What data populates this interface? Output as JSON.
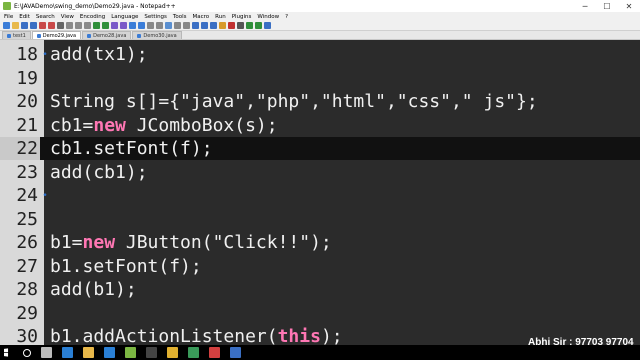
{
  "window": {
    "title": "E:\\JAVADemo\\swing_demo\\Demo29.java - Notepad++",
    "minimize": "─",
    "maximize": "☐",
    "close": "✕"
  },
  "menu": [
    "File",
    "Edit",
    "Search",
    "View",
    "Encoding",
    "Language",
    "Settings",
    "Tools",
    "Macro",
    "Run",
    "Plugins",
    "Window",
    "?"
  ],
  "tabs": [
    {
      "label": "test1",
      "active": false
    },
    {
      "label": "Demo29.java",
      "active": true
    },
    {
      "label": "Demo28.java",
      "active": false
    },
    {
      "label": "Demo30.java",
      "active": false
    }
  ],
  "editor": {
    "current_line": 22,
    "lines": [
      {
        "num": "18",
        "fold": "•",
        "segments": [
          {
            "t": "add(tx1);",
            "k": ""
          }
        ]
      },
      {
        "num": "19",
        "fold": "",
        "segments": []
      },
      {
        "num": "20",
        "fold": "",
        "segments": [
          {
            "t": "String s[]={\"java\",\"php\",\"html\",\"css\",\" js\"};",
            "k": ""
          }
        ]
      },
      {
        "num": "21",
        "fold": "",
        "segments": [
          {
            "t": "cb1=",
            "k": ""
          },
          {
            "t": "new",
            "k": "kw"
          },
          {
            "t": " JComboBox(s);",
            "k": ""
          }
        ]
      },
      {
        "num": "22",
        "fold": "",
        "segments": [
          {
            "t": "cb1.setFont(f);",
            "k": ""
          }
        ]
      },
      {
        "num": "23",
        "fold": "",
        "segments": [
          {
            "t": "add(cb1);",
            "k": ""
          }
        ]
      },
      {
        "num": "24",
        "fold": "•",
        "segments": []
      },
      {
        "num": "25",
        "fold": "",
        "segments": []
      },
      {
        "num": "26",
        "fold": "",
        "segments": [
          {
            "t": "b1=",
            "k": ""
          },
          {
            "t": "new",
            "k": "kw"
          },
          {
            "t": " JButton(\"Click!!\");",
            "k": ""
          }
        ]
      },
      {
        "num": "27",
        "fold": "",
        "segments": [
          {
            "t": "b1.setFont(f);",
            "k": ""
          }
        ]
      },
      {
        "num": "28",
        "fold": "",
        "segments": [
          {
            "t": "add(b1);",
            "k": ""
          }
        ]
      },
      {
        "num": "29",
        "fold": "",
        "segments": []
      },
      {
        "num": "30",
        "fold": "",
        "segments": [
          {
            "t": "b1.addActionListener(",
            "k": ""
          },
          {
            "t": "this",
            "k": "kw"
          },
          {
            "t": ");",
            "k": ""
          }
        ]
      }
    ]
  },
  "caption": "Abhi Sir : 97703 97704",
  "toolbar_icons": [
    "new-file-icon",
    "open-icon",
    "save-icon",
    "save-all-icon",
    "close-icon",
    "close-all-icon",
    "print-icon",
    "cut-icon",
    "copy-icon",
    "paste-icon",
    "undo-icon",
    "redo-icon",
    "find-icon",
    "replace-icon",
    "zoom-in-icon",
    "zoom-out-icon",
    "sync-v-icon",
    "sync-h-icon",
    "wrap-icon",
    "show-all-icon",
    "indent-guide-icon",
    "lang-icon",
    "doc-map-icon",
    "function-list-icon",
    "folder-icon",
    "record-icon",
    "stop-icon",
    "play-icon",
    "play-multi-icon",
    "save-macro-icon"
  ],
  "toolbar_colors": [
    "#3b7dd8",
    "#e8b84a",
    "#3a6fc4",
    "#3a6fc4",
    "#c94a4a",
    "#c94a4a",
    "#666666",
    "#8a8a8a",
    "#8a8a8a",
    "#8a8a8a",
    "#2f8f3a",
    "#2f8f3a",
    "#7a5ac8",
    "#7a5ac8",
    "#3b7dd8",
    "#3b7dd8",
    "#888888",
    "#888888",
    "#5a8fd0",
    "#888888",
    "#888888",
    "#3a6fc4",
    "#3a6fc4",
    "#3a6fc4",
    "#d89a2a",
    "#c03030",
    "#555555",
    "#2f8f3a",
    "#2f8f3a",
    "#3a6fc4"
  ],
  "taskbar_icons": [
    {
      "name": "start-icon",
      "color": "#ffffff"
    },
    {
      "name": "search-icon",
      "color": "#ffffff"
    },
    {
      "name": "task-view-icon",
      "color": "#bbbbbb"
    },
    {
      "name": "edge-icon",
      "color": "#2a7fd4"
    },
    {
      "name": "explorer-icon",
      "color": "#e8b84a"
    },
    {
      "name": "store-icon",
      "color": "#2a7fd4"
    },
    {
      "name": "notepadpp-icon",
      "color": "#7bb642"
    },
    {
      "name": "cmd-icon",
      "color": "#444444"
    },
    {
      "name": "chrome-icon",
      "color": "#e0b030"
    },
    {
      "name": "app-icon",
      "color": "#3a9a5a"
    },
    {
      "name": "settings-icon",
      "color": "#d44040"
    },
    {
      "name": "video-icon",
      "color": "#3a6fc4"
    }
  ]
}
